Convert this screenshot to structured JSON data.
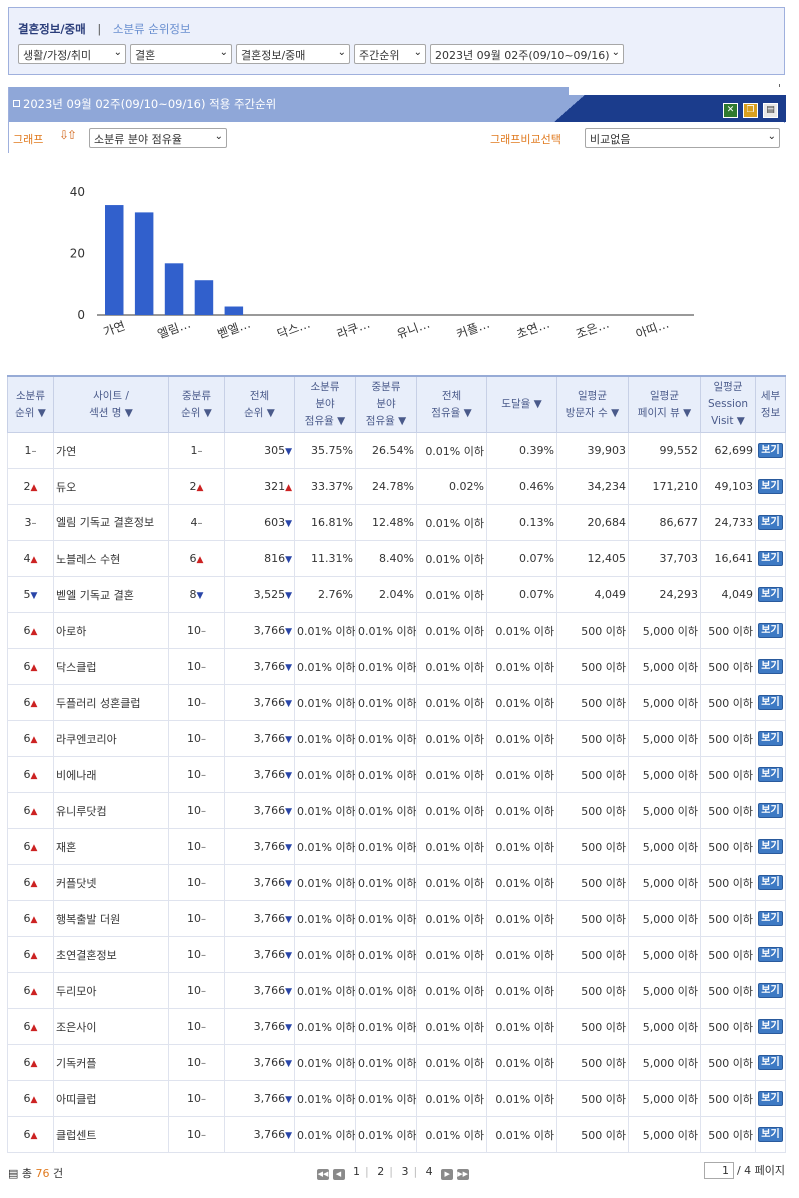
{
  "tabs": {
    "active": "결혼정보/중매",
    "separator": "|",
    "inactive": "소분류 순위정보"
  },
  "selects": {
    "cat1": "생활/가정/취미",
    "cat2": "결혼",
    "cat3": "결혼정보/중매",
    "period": "주간순위",
    "week": "2023년 09월 02주(09/10~09/16)"
  },
  "title": "2023년 09월 02주(09/10~09/16) 적용 주간순위",
  "graph": {
    "label": "그래프",
    "metric": "소분류 분야 점유율",
    "compare_label": "그래프비교선택",
    "compare_value": "비교없음"
  },
  "chart_data": {
    "type": "bar",
    "categories": [
      "가연",
      "엘림…",
      "벧엘…",
      "닥스…",
      "라쿠…",
      "유니…",
      "커플…",
      "초연…",
      "조은…",
      "아띠…"
    ],
    "all_categories": [
      "가연",
      "듀오",
      "엘림…",
      "노블레스…",
      "벧엘…",
      "아로하",
      "닥스…",
      "두플…",
      "라쿠…",
      "비에…",
      "유니…",
      "재혼",
      "커플…",
      "행복…",
      "초연…",
      "두리…",
      "조은…",
      "기독…",
      "아띠…",
      "클럽…"
    ],
    "values": [
      35.75,
      33.37,
      16.81,
      11.31,
      2.76,
      0,
      0,
      0,
      0,
      0,
      0,
      0,
      0,
      0,
      0,
      0,
      0,
      0,
      0,
      0
    ],
    "ylim": [
      0,
      40
    ],
    "yticks": [
      "0",
      "20",
      "40"
    ],
    "color": "#3160cc"
  },
  "table": {
    "headers": [
      "소분류\n순위 ▼",
      "사이트 /\n섹션 명 ▼",
      "중분류\n순위 ▼",
      "전체\n순위 ▼",
      "소분류\n분야\n점유율 ▼",
      "중분류\n분야\n점유율 ▼",
      "전체\n점유율 ▼",
      "도달율 ▼",
      "일평균\n방문자 수 ▼",
      "일평균\n페이지 뷰 ▼",
      "일평균\nSession\nVisit ▼",
      "세부\n정보"
    ],
    "detail_label": "보기",
    "rows": [
      {
        "rank": "1",
        "rt": "same",
        "site": "가연",
        "mid": "1",
        "mt": "same",
        "total": "305",
        "tt": "down",
        "sub": "35.75%",
        "midshare": "26.54%",
        "all": "0.01% 이하",
        "reach": "0.39%",
        "uv": "39,903",
        "pv": "99,552",
        "sv": "62,699"
      },
      {
        "rank": "2",
        "rt": "up",
        "site": "듀오",
        "mid": "2",
        "mt": "up",
        "total": "321",
        "tt": "up",
        "sub": "33.37%",
        "midshare": "24.78%",
        "all": "0.02%",
        "reach": "0.46%",
        "uv": "34,234",
        "pv": "171,210",
        "sv": "49,103"
      },
      {
        "rank": "3",
        "rt": "same",
        "site": "엘림 기독교 결혼정보",
        "mid": "4",
        "mt": "same",
        "total": "603",
        "tt": "down",
        "sub": "16.81%",
        "midshare": "12.48%",
        "all": "0.01% 이하",
        "reach": "0.13%",
        "uv": "20,684",
        "pv": "86,677",
        "sv": "24,733"
      },
      {
        "rank": "4",
        "rt": "up",
        "site": "노블레스 수현",
        "mid": "6",
        "mt": "up",
        "total": "816",
        "tt": "down",
        "sub": "11.31%",
        "midshare": "8.40%",
        "all": "0.01% 이하",
        "reach": "0.07%",
        "uv": "12,405",
        "pv": "37,703",
        "sv": "16,641"
      },
      {
        "rank": "5",
        "rt": "down",
        "site": "벧엘 기독교 결혼",
        "mid": "8",
        "mt": "down",
        "total": "3,525",
        "tt": "down",
        "sub": "2.76%",
        "midshare": "2.04%",
        "all": "0.01% 이하",
        "reach": "0.07%",
        "uv": "4,049",
        "pv": "24,293",
        "sv": "4,049"
      },
      {
        "rank": "6",
        "rt": "up",
        "site": "아로하",
        "mid": "10",
        "mt": "same",
        "total": "3,766",
        "tt": "down",
        "sub": "0.01% 이하",
        "midshare": "0.01% 이하",
        "all": "0.01% 이하",
        "reach": "0.01% 이하",
        "uv": "500 이하",
        "pv": "5,000 이하",
        "sv": "500 이하"
      },
      {
        "rank": "6",
        "rt": "up",
        "site": "닥스클럽",
        "mid": "10",
        "mt": "same",
        "total": "3,766",
        "tt": "down",
        "sub": "0.01% 이하",
        "midshare": "0.01% 이하",
        "all": "0.01% 이하",
        "reach": "0.01% 이하",
        "uv": "500 이하",
        "pv": "5,000 이하",
        "sv": "500 이하"
      },
      {
        "rank": "6",
        "rt": "up",
        "site": "두플러리 성혼클럽",
        "mid": "10",
        "mt": "same",
        "total": "3,766",
        "tt": "down",
        "sub": "0.01% 이하",
        "midshare": "0.01% 이하",
        "all": "0.01% 이하",
        "reach": "0.01% 이하",
        "uv": "500 이하",
        "pv": "5,000 이하",
        "sv": "500 이하"
      },
      {
        "rank": "6",
        "rt": "up",
        "site": "라쿠엔코리아",
        "mid": "10",
        "mt": "same",
        "total": "3,766",
        "tt": "down",
        "sub": "0.01% 이하",
        "midshare": "0.01% 이하",
        "all": "0.01% 이하",
        "reach": "0.01% 이하",
        "uv": "500 이하",
        "pv": "5,000 이하",
        "sv": "500 이하"
      },
      {
        "rank": "6",
        "rt": "up",
        "site": "비에나래",
        "mid": "10",
        "mt": "same",
        "total": "3,766",
        "tt": "down",
        "sub": "0.01% 이하",
        "midshare": "0.01% 이하",
        "all": "0.01% 이하",
        "reach": "0.01% 이하",
        "uv": "500 이하",
        "pv": "5,000 이하",
        "sv": "500 이하"
      },
      {
        "rank": "6",
        "rt": "up",
        "site": "유니루닷컴",
        "mid": "10",
        "mt": "same",
        "total": "3,766",
        "tt": "down",
        "sub": "0.01% 이하",
        "midshare": "0.01% 이하",
        "all": "0.01% 이하",
        "reach": "0.01% 이하",
        "uv": "500 이하",
        "pv": "5,000 이하",
        "sv": "500 이하"
      },
      {
        "rank": "6",
        "rt": "up",
        "site": "재혼",
        "mid": "10",
        "mt": "same",
        "total": "3,766",
        "tt": "down",
        "sub": "0.01% 이하",
        "midshare": "0.01% 이하",
        "all": "0.01% 이하",
        "reach": "0.01% 이하",
        "uv": "500 이하",
        "pv": "5,000 이하",
        "sv": "500 이하"
      },
      {
        "rank": "6",
        "rt": "up",
        "site": "커플닷넷",
        "mid": "10",
        "mt": "same",
        "total": "3,766",
        "tt": "down",
        "sub": "0.01% 이하",
        "midshare": "0.01% 이하",
        "all": "0.01% 이하",
        "reach": "0.01% 이하",
        "uv": "500 이하",
        "pv": "5,000 이하",
        "sv": "500 이하"
      },
      {
        "rank": "6",
        "rt": "up",
        "site": "행복출발 더원",
        "mid": "10",
        "mt": "same",
        "total": "3,766",
        "tt": "down",
        "sub": "0.01% 이하",
        "midshare": "0.01% 이하",
        "all": "0.01% 이하",
        "reach": "0.01% 이하",
        "uv": "500 이하",
        "pv": "5,000 이하",
        "sv": "500 이하"
      },
      {
        "rank": "6",
        "rt": "up",
        "site": "초연결혼정보",
        "mid": "10",
        "mt": "same",
        "total": "3,766",
        "tt": "down",
        "sub": "0.01% 이하",
        "midshare": "0.01% 이하",
        "all": "0.01% 이하",
        "reach": "0.01% 이하",
        "uv": "500 이하",
        "pv": "5,000 이하",
        "sv": "500 이하"
      },
      {
        "rank": "6",
        "rt": "up",
        "site": "두리모아",
        "mid": "10",
        "mt": "same",
        "total": "3,766",
        "tt": "down",
        "sub": "0.01% 이하",
        "midshare": "0.01% 이하",
        "all": "0.01% 이하",
        "reach": "0.01% 이하",
        "uv": "500 이하",
        "pv": "5,000 이하",
        "sv": "500 이하"
      },
      {
        "rank": "6",
        "rt": "up",
        "site": "조은사이",
        "mid": "10",
        "mt": "same",
        "total": "3,766",
        "tt": "down",
        "sub": "0.01% 이하",
        "midshare": "0.01% 이하",
        "all": "0.01% 이하",
        "reach": "0.01% 이하",
        "uv": "500 이하",
        "pv": "5,000 이하",
        "sv": "500 이하"
      },
      {
        "rank": "6",
        "rt": "up",
        "site": "기독커플",
        "mid": "10",
        "mt": "same",
        "total": "3,766",
        "tt": "down",
        "sub": "0.01% 이하",
        "midshare": "0.01% 이하",
        "all": "0.01% 이하",
        "reach": "0.01% 이하",
        "uv": "500 이하",
        "pv": "5,000 이하",
        "sv": "500 이하"
      },
      {
        "rank": "6",
        "rt": "up",
        "site": "아띠클럽",
        "mid": "10",
        "mt": "same",
        "total": "3,766",
        "tt": "down",
        "sub": "0.01% 이하",
        "midshare": "0.01% 이하",
        "all": "0.01% 이하",
        "reach": "0.01% 이하",
        "uv": "500 이하",
        "pv": "5,000 이하",
        "sv": "500 이하"
      },
      {
        "rank": "6",
        "rt": "up",
        "site": "클럽센트",
        "mid": "10",
        "mt": "same",
        "total": "3,766",
        "tt": "down",
        "sub": "0.01% 이하",
        "midshare": "0.01% 이하",
        "all": "0.01% 이하",
        "reach": "0.01% 이하",
        "uv": "500 이하",
        "pv": "5,000 이하",
        "sv": "500 이하"
      }
    ]
  },
  "footer": {
    "count": "76",
    "count_suffix": "건",
    "pages": [
      "1",
      "2",
      "3",
      "4"
    ],
    "current_page": "1",
    "total_pages": "/ 4 페이지"
  },
  "colors": {
    "accent": "#1b3c8c",
    "header_bg": "#8fa7d8",
    "orange": "#e07a1f",
    "bar": "#3160cc",
    "up": "#cc2222",
    "down": "#2a46a8"
  }
}
